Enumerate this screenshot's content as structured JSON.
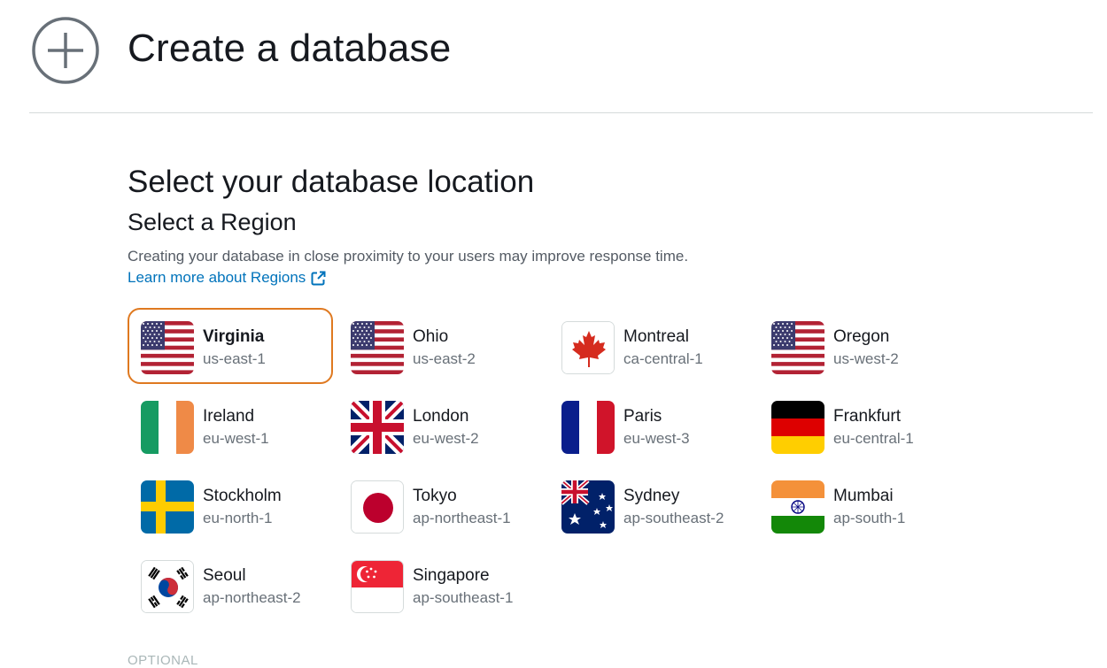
{
  "header": {
    "title": "Create a database",
    "icon": "plus-circle-icon"
  },
  "location": {
    "title": "Select your database location",
    "subtitle": "Select a Region",
    "description": "Creating your database in close proximity to your users may improve response time.",
    "learn_more": "Learn more about Regions"
  },
  "selected_color": "#df7920",
  "regions": [
    {
      "name": "Virginia",
      "code": "us-east-1",
      "flag": "us-flag-icon",
      "selected": true
    },
    {
      "name": "Ohio",
      "code": "us-east-2",
      "flag": "us-flag-icon",
      "selected": false
    },
    {
      "name": "Montreal",
      "code": "ca-central-1",
      "flag": "canada-flag-icon",
      "selected": false
    },
    {
      "name": "Oregon",
      "code": "us-west-2",
      "flag": "us-flag-icon",
      "selected": false
    },
    {
      "name": "Ireland",
      "code": "eu-west-1",
      "flag": "ireland-flag-icon",
      "selected": false
    },
    {
      "name": "London",
      "code": "eu-west-2",
      "flag": "uk-flag-icon",
      "selected": false
    },
    {
      "name": "Paris",
      "code": "eu-west-3",
      "flag": "france-flag-icon",
      "selected": false
    },
    {
      "name": "Frankfurt",
      "code": "eu-central-1",
      "flag": "germany-flag-icon",
      "selected": false
    },
    {
      "name": "Stockholm",
      "code": "eu-north-1",
      "flag": "sweden-flag-icon",
      "selected": false
    },
    {
      "name": "Tokyo",
      "code": "ap-northeast-1",
      "flag": "japan-flag-icon",
      "selected": false
    },
    {
      "name": "Sydney",
      "code": "ap-southeast-2",
      "flag": "australia-flag-icon",
      "selected": false
    },
    {
      "name": "Mumbai",
      "code": "ap-south-1",
      "flag": "india-flag-icon",
      "selected": false
    },
    {
      "name": "Seoul",
      "code": "ap-northeast-2",
      "flag": "korea-flag-icon",
      "selected": false
    },
    {
      "name": "Singapore",
      "code": "ap-southeast-1",
      "flag": "singapore-flag-icon",
      "selected": false
    }
  ],
  "optional_label": "OPTIONAL"
}
